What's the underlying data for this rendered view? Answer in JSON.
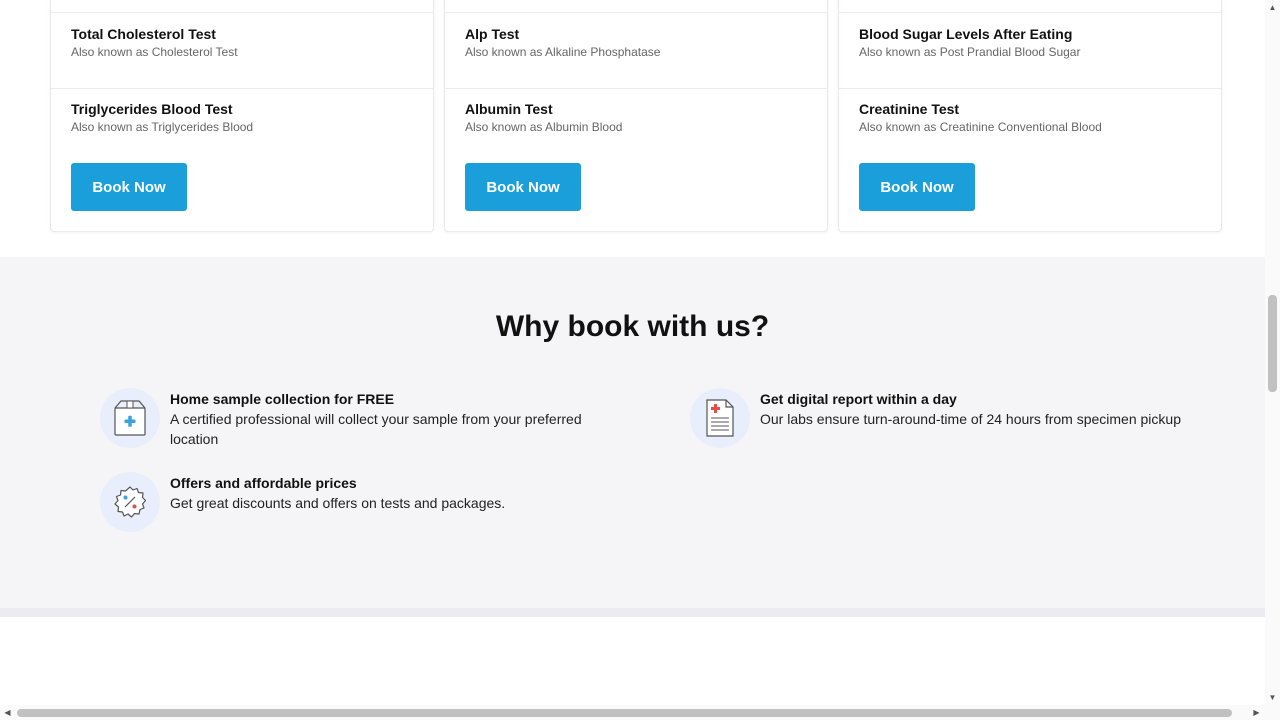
{
  "cards": [
    {
      "tests": [
        {
          "name": "Total Cholesterol Test",
          "alias": "Also known as Cholesterol Test"
        },
        {
          "name": "Triglycerides Blood Test",
          "alias": "Also known as Triglycerides Blood"
        }
      ],
      "button": "Book Now"
    },
    {
      "tests": [
        {
          "name": "Alp Test",
          "alias": "Also known as Alkaline Phosphatase"
        },
        {
          "name": "Albumin Test",
          "alias": "Also known as Albumin Blood"
        }
      ],
      "button": "Book Now"
    },
    {
      "tests": [
        {
          "name": "Blood Sugar Levels After Eating",
          "alias": "Also known as Post Prandial Blood Sugar"
        },
        {
          "name": "Creatinine Test",
          "alias": "Also known as Creatinine Conventional Blood"
        }
      ],
      "button": "Book Now"
    }
  ],
  "why": {
    "title": "Why book with us?",
    "features": [
      {
        "title": "Home sample collection for FREE",
        "desc": "A certified professional will collect your sample from your preferred location",
        "icon": "sample-box-icon"
      },
      {
        "title": "Get digital report within a day",
        "desc": "Our labs ensure turn-around-time of 24 hours from specimen pickup",
        "icon": "report-document-icon"
      },
      {
        "title": "Offers and affordable prices",
        "desc": "Get great discounts and offers on tests and packages.",
        "icon": "discount-badge-icon"
      }
    ]
  },
  "colors": {
    "accent": "#1a9fdb",
    "section_bg": "#f5f5f7",
    "icon_circle": "#e8eefb"
  }
}
